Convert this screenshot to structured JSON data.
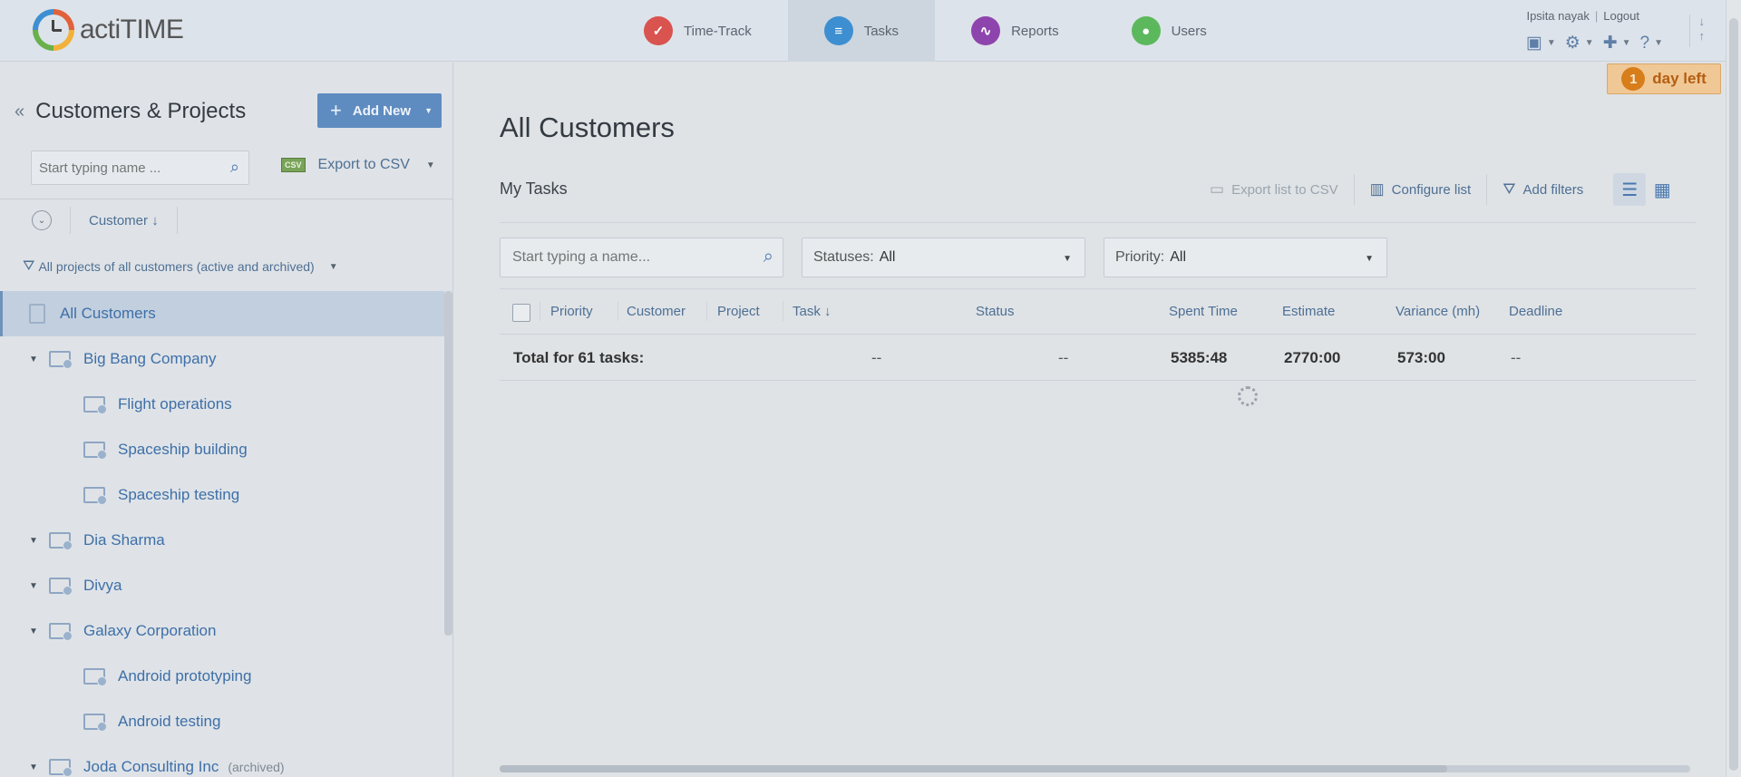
{
  "app": {
    "logo_text": "actiTIME"
  },
  "nav": {
    "tabs": [
      {
        "label": "Time-Track",
        "color": "#d9534f"
      },
      {
        "label": "Tasks",
        "color": "#3d8fd1"
      },
      {
        "label": "Reports",
        "color": "#8e44ad"
      },
      {
        "label": "Users",
        "color": "#5cb85c"
      }
    ]
  },
  "user": {
    "name": "Ipsita nayak",
    "logout": "Logout"
  },
  "trial": {
    "count": "1",
    "text": "day left"
  },
  "left_panel": {
    "title": "Customers & Projects",
    "add_new": "Add New",
    "search_placeholder": "Start typing name ...",
    "csv_badge": "CSV",
    "export_csv": "Export to CSV",
    "sort_column": "Customer",
    "filter": "All projects of all customers (active and archived)",
    "tree": [
      {
        "type": "all",
        "label": "All Customers"
      },
      {
        "type": "customer",
        "label": "Big Bang Company"
      },
      {
        "type": "project",
        "label": "Flight operations"
      },
      {
        "type": "project",
        "label": "Spaceship building"
      },
      {
        "type": "project",
        "label": "Spaceship testing"
      },
      {
        "type": "customer",
        "label": "Dia Sharma"
      },
      {
        "type": "customer",
        "label": "Divya"
      },
      {
        "type": "customer",
        "label": "Galaxy Corporation"
      },
      {
        "type": "project",
        "label": "Android prototyping"
      },
      {
        "type": "project",
        "label": "Android testing"
      },
      {
        "type": "customer",
        "label": "Joda Consulting Inc",
        "note": "(archived)"
      }
    ]
  },
  "main": {
    "title": "All Customers",
    "subtitle": "My Tasks",
    "toolbar": {
      "export": "Export list to CSV",
      "configure": "Configure list",
      "filters": "Add filters"
    },
    "search_placeholder": "Start typing a name...",
    "statuses_label": "Statuses:",
    "statuses_value": "All",
    "priority_label": "Priority:",
    "priority_value": "All",
    "columns": [
      "Priority",
      "Customer",
      "Project",
      "Task",
      "Status",
      "Spent Time",
      "Estimate",
      "Variance (mh)",
      "Deadline"
    ],
    "total": {
      "label": "Total for 61 tasks:",
      "task": "--",
      "status": "--",
      "spent": "5385:48",
      "estimate": "2770:00",
      "variance": "573:00",
      "deadline": "--"
    }
  }
}
